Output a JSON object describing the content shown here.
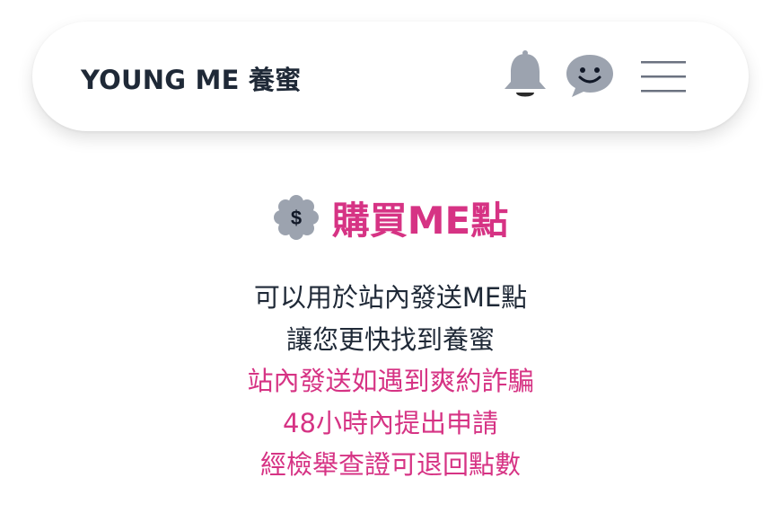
{
  "header": {
    "brand": "YOUNG ME 養蜜",
    "icons": {
      "notifications": "bell-icon",
      "messages": "chat-smile-icon",
      "menu": "hamburger-menu-icon"
    }
  },
  "main": {
    "title_icon": "dollar-badge-icon",
    "title": "購買ME點",
    "description": [
      "可以用於站內發送ME點",
      "讓您更快找到養蜜",
      "站內發送如遇到爽約詐騙",
      "48小時內提出申請",
      "經檢舉查證可退回點數"
    ]
  },
  "colors": {
    "text_dark": "#1f2937",
    "accent_pink": "#d63384",
    "icon_gray": "#9ca3af",
    "icon_dark": "#374151"
  }
}
